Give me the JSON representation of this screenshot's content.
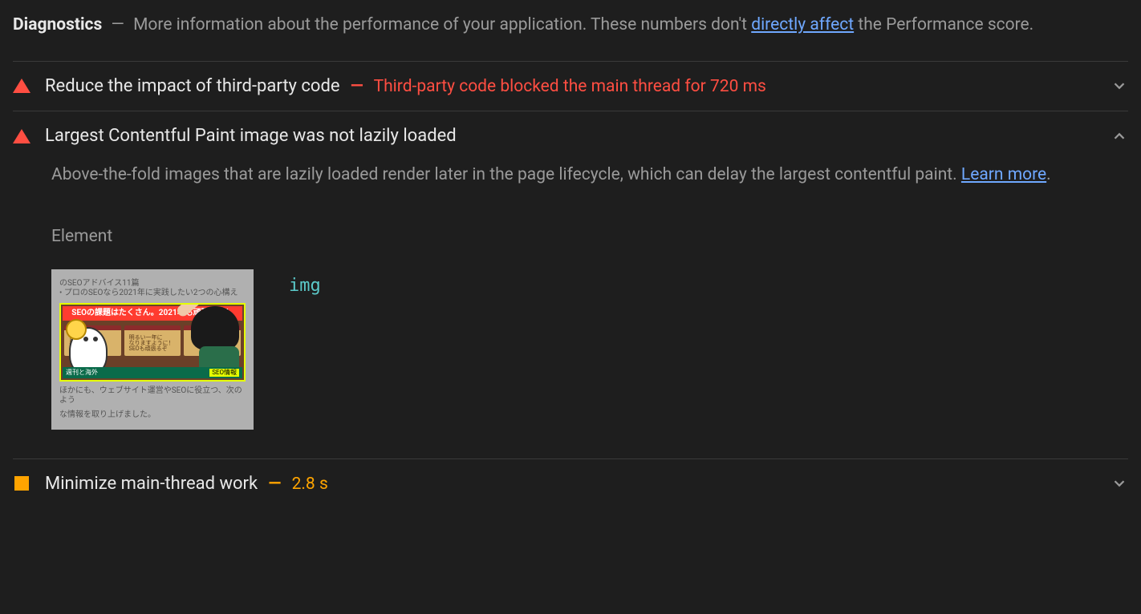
{
  "header": {
    "title": "Diagnostics",
    "dash": "—",
    "desc_before": "More information about the performance of your application. These numbers don't ",
    "link_text": "directly affect",
    "desc_after": " the Performance score."
  },
  "audits": [
    {
      "status": "fail",
      "title": "Reduce the impact of third-party code",
      "separator": "—",
      "display_text": "Third-party code blocked the main thread for 720 ms",
      "expanded": false
    },
    {
      "status": "fail",
      "title": "Largest Contentful Paint image was not lazily loaded",
      "separator": "",
      "display_text": "",
      "expanded": true,
      "description": "Above-the-fold images that are lazily loaded render later in the page lifecycle, which can delay the largest contentful paint. ",
      "learn_more": "Learn more",
      "period": ".",
      "element_label": "Element",
      "element_tag": "img",
      "thumbnail": {
        "line1": "のSEOアドバイス11篇",
        "line2": "• プロのSEOなら2021年に実践したい2つの心構え",
        "banner": "SEOの課題はたくさん。2021年も頑張ろう！",
        "ema2_line1": "明るい一年に",
        "ema2_line2": "なりますように！",
        "ema2_line3": "SEOも頑張るぞ",
        "caption_left": "週刊と海外",
        "caption_tag": "SEO情報",
        "after1": "ほかにも、ウェブサイト運営やSEOに役立つ、次のよう",
        "after2": "な情報を取り上げました。"
      }
    },
    {
      "status": "average",
      "title": "Minimize main-thread work",
      "separator": "—",
      "display_text": "2.8 s",
      "expanded": false
    }
  ]
}
